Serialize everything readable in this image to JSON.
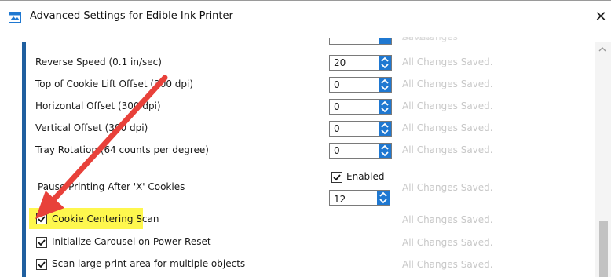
{
  "window": {
    "title": "Advanced Settings for Edible Ink Printer",
    "close_glyph": "✕"
  },
  "settings": {
    "reverse_speed": {
      "label": "Reverse Speed (0.1 in/sec)",
      "value": "20",
      "status": "All Changes Saved."
    },
    "top_lift_offset": {
      "label": "Top of Cookie Lift Offset (300 dpi)",
      "value": "0",
      "status": "All Changes Saved."
    },
    "horizontal_offset": {
      "label": "Horizontal Offset (300 dpi)",
      "value": "0",
      "status": "All Changes Saved."
    },
    "vertical_offset": {
      "label": "Vertical Offset (300 dpi)",
      "value": "0",
      "status": "All Changes Saved."
    },
    "tray_rotation": {
      "label": "Tray Rotation (64 counts per degree)",
      "value": "0",
      "status": "All Changes Saved."
    },
    "pause_printing": {
      "label": "Pause Printing After 'X' Cookies",
      "enabled_label": "Enabled",
      "enabled": true,
      "value": "12",
      "status": "All Changes Saved."
    },
    "cookie_centering": {
      "label": "Cookie Centering Scan",
      "checked": true,
      "status": "All Changes Saved."
    },
    "initialize_carousel": {
      "label": "Initialize Carousel on Power Reset",
      "checked": true,
      "status": "All Changes Saved."
    },
    "scan_large_area": {
      "label": "Scan large print area for multiple objects",
      "checked": true,
      "status": "All Changes Saved."
    }
  },
  "colors": {
    "accent": "#1f5f9f",
    "spin_button": "#1f78d1",
    "highlight": "#fef74e",
    "annotation_arrow": "#e8413a",
    "saved_text": "#c8c8c8"
  },
  "icons": {
    "app": "printer-window-icon",
    "spin": "chevron-up-down-icon",
    "checkbox": "checkmark-icon",
    "annotation": "red-arrow"
  }
}
